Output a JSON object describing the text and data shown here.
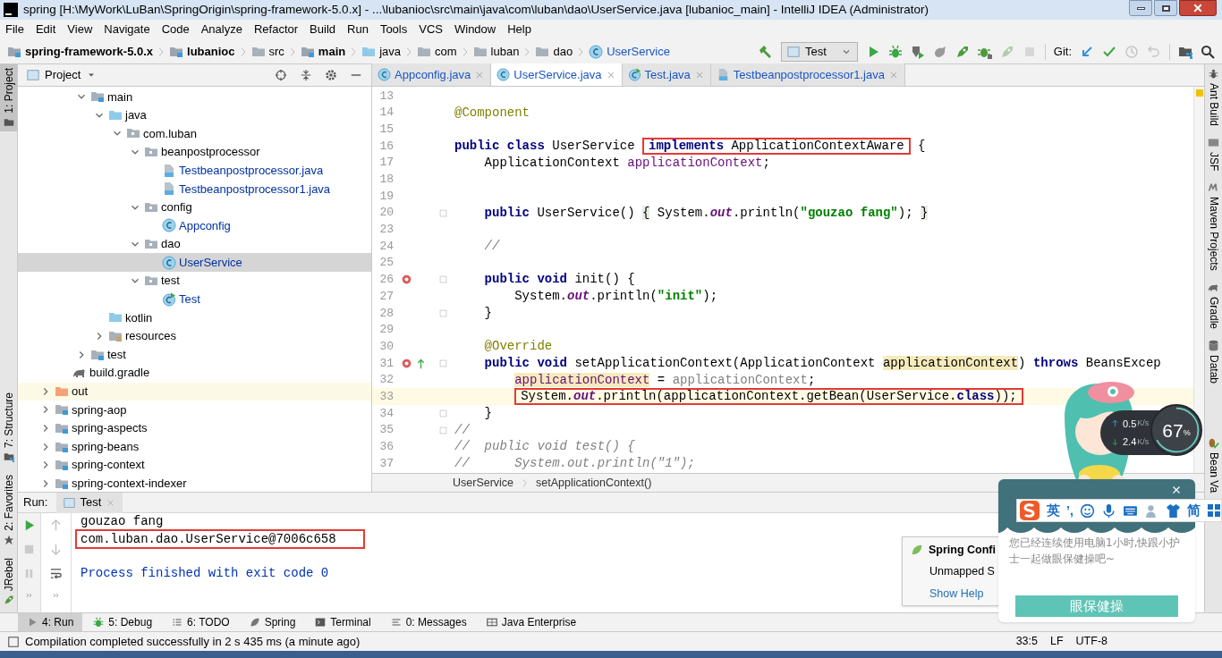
{
  "window": {
    "title": "spring [H:\\MyWork\\LuBan\\SpringOrigin\\spring-framework-5.0.x] - ...\\lubanioc\\src\\main\\java\\com\\luban\\dao\\UserService.java [lubanioc_main] - IntelliJ IDEA (Administrator)"
  },
  "menu": [
    "File",
    "Edit",
    "View",
    "Navigate",
    "Code",
    "Analyze",
    "Refactor",
    "Build",
    "Run",
    "Tools",
    "VCS",
    "Window",
    "Help"
  ],
  "breadcrumbs": [
    {
      "label": "spring-framework-5.0.x",
      "kind": "module",
      "bold": true
    },
    {
      "label": "lubanioc",
      "kind": "module",
      "bold": true
    },
    {
      "label": "src",
      "kind": "folder",
      "bold": false
    },
    {
      "label": "main",
      "kind": "module",
      "bold": true
    },
    {
      "label": "java",
      "kind": "source",
      "bold": false
    },
    {
      "label": "com",
      "kind": "folder",
      "bold": false
    },
    {
      "label": "luban",
      "kind": "folder",
      "bold": false
    },
    {
      "label": "dao",
      "kind": "folder",
      "bold": false
    },
    {
      "label": "UserService",
      "kind": "class",
      "bold": false
    }
  ],
  "toolbar": {
    "run_config": "Test",
    "git_label": "Git:",
    "buttons": [
      {
        "kind": "build",
        "disabled": false
      },
      {
        "kind": "run",
        "disabled": false
      },
      {
        "kind": "debug",
        "disabled": false
      },
      {
        "kind": "coverage",
        "disabled": false
      },
      {
        "kind": "profile",
        "disabled": false
      },
      {
        "kind": "rocket",
        "disabled": false
      },
      {
        "kind": "rocket-bug",
        "disabled": false
      },
      {
        "kind": "rocket",
        "disabled": true
      },
      {
        "kind": "stop",
        "disabled": true
      }
    ],
    "git_buttons": [
      {
        "kind": "update",
        "disabled": false
      },
      {
        "kind": "commit",
        "disabled": false
      },
      {
        "kind": "history",
        "disabled": true
      },
      {
        "kind": "revert",
        "disabled": true
      },
      {
        "kind": "structure",
        "disabled": false
      },
      {
        "kind": "search",
        "disabled": false
      }
    ]
  },
  "left_strip": [
    {
      "label": "1: Project",
      "kind": "project",
      "selected": true
    },
    {
      "label": "7: Structure",
      "kind": "structure",
      "selected": false
    },
    {
      "label": "2: Favorites",
      "kind": "star",
      "selected": false
    },
    {
      "label": "JRebel",
      "kind": "rocket",
      "selected": false
    }
  ],
  "right_strip": [
    {
      "label": "Ant Build",
      "kind": "ant"
    },
    {
      "label": "JSF",
      "kind": "jsf"
    },
    {
      "label": "Maven Projects",
      "kind": "maven"
    },
    {
      "label": "Gradle",
      "kind": "gradle"
    },
    {
      "label": "Datab",
      "kind": "database"
    },
    {
      "label": "Bean Va",
      "kind": "bean"
    }
  ],
  "project_panel": {
    "title": "Project",
    "tree": [
      {
        "children": [
          {
            "children": [
              {
                "label": "main",
                "kind": "source-root",
                "expanded": true,
                "selected": false,
                "children": [
                  {
                    "label": "java",
                    "kind": "source",
                    "expanded": true,
                    "selected": false,
                    "children": [
                      {
                        "label": "com.luban",
                        "kind": "package",
                        "expanded": true,
                        "selected": false,
                        "children": [
                          {
                            "label": "beanpostprocessor",
                            "kind": "package",
                            "expanded": true,
                            "selected": false,
                            "children": [
                              {
                                "label": "Testbeanpostprocessor.java",
                                "kind": "java-file",
                                "selected": false,
                                "color": "#0032a0"
                              },
                              {
                                "label": "Testbeanpostprocessor1.java",
                                "kind": "java-file",
                                "selected": false,
                                "color": "#0032a0"
                              }
                            ]
                          },
                          {
                            "label": "config",
                            "kind": "package",
                            "expanded": true,
                            "selected": false,
                            "children": [
                              {
                                "label": "Appconfig",
                                "kind": "class",
                                "selected": false,
                                "color": "#0032a0"
                              }
                            ]
                          },
                          {
                            "label": "dao",
                            "kind": "package",
                            "expanded": true,
                            "selected": false,
                            "children": [
                              {
                                "label": "UserService",
                                "kind": "class",
                                "selected": true,
                                "color": "#0032a0"
                              }
                            ]
                          },
                          {
                            "label": "test",
                            "kind": "package",
                            "expanded": true,
                            "selected": false,
                            "children": [
                              {
                                "label": "Test",
                                "kind": "test-class",
                                "selected": false,
                                "color": "#0032a0"
                              }
                            ]
                          }
                        ]
                      }
                    ]
                  },
                  {
                    "label": "kotlin",
                    "kind": "source",
                    "selected": false
                  },
                  {
                    "label": "resources",
                    "kind": "resources",
                    "expanded": false,
                    "selected": false
                  }
                ]
              },
              {
                "label": "test",
                "kind": "source-root",
                "expanded": false,
                "selected": false
              }
            ]
          },
          {
            "label": "build.gradle",
            "kind": "gradle",
            "selected": false
          }
        ]
      },
      {
        "label": "out",
        "kind": "excluded",
        "expanded": false,
        "selected": false
      },
      {
        "label": "spring-aop",
        "kind": "source-root",
        "expanded": false,
        "selected": false
      },
      {
        "label": "spring-aspects",
        "kind": "source-root",
        "expanded": false,
        "selected": false
      },
      {
        "label": "spring-beans",
        "kind": "source-root",
        "expanded": false,
        "selected": false
      },
      {
        "label": "spring-context",
        "kind": "source-root",
        "expanded": false,
        "selected": false
      },
      {
        "label": "spring-context-indexer",
        "kind": "source-root",
        "expanded": false,
        "selected": false
      }
    ]
  },
  "editor_tabs": [
    {
      "label": "Appconfig.java",
      "kind": "class",
      "selected": false
    },
    {
      "label": "UserService.java",
      "kind": "class",
      "selected": true
    },
    {
      "label": "Test.java",
      "kind": "test-class",
      "selected": false
    },
    {
      "label": "Testbeanpostprocessor1.java",
      "kind": "java-file",
      "selected": false
    }
  ],
  "code": [
    {
      "number": "13"
    },
    {
      "number": "14",
      "tokens": [
        {
          "text": "@Component",
          "kind": "ann"
        }
      ]
    },
    {
      "number": "15"
    },
    {
      "number": "16",
      "tokens": [
        {
          "text": "public class",
          "kind": "kw"
        },
        {
          "text": " UserService ",
          "kind": "plain"
        },
        {
          "text": "implements",
          "kind": "kw",
          "boxed": true
        },
        {
          "text": " ApplicationContextAware",
          "kind": "plain",
          "boxed": true
        },
        {
          "text": " {",
          "kind": "plain"
        }
      ]
    },
    {
      "number": "17",
      "kind": "member",
      "tokens": [
        {
          "text": "ApplicationContext ",
          "kind": "plain"
        },
        {
          "text": "applicationContext",
          "kind": "field"
        },
        {
          "text": ";",
          "kind": "plain"
        }
      ]
    },
    {
      "number": "18"
    },
    {
      "number": "19"
    },
    {
      "number": "20",
      "kind": "member",
      "fold": true,
      "tokens": [
        {
          "text": "public",
          "kind": "kw"
        },
        {
          "text": " UserService() ",
          "kind": "plain"
        },
        {
          "text": "{",
          "kind": "folded"
        },
        {
          "text": " System.",
          "kind": "plain"
        },
        {
          "text": "out",
          "kind": "static"
        },
        {
          "text": ".println(",
          "kind": "plain"
        },
        {
          "text": "\"gouzao fang\"",
          "kind": "str"
        },
        {
          "text": "); ",
          "kind": "plain"
        },
        {
          "text": "}",
          "kind": "folded"
        }
      ]
    },
    {
      "number": "23"
    },
    {
      "number": "24",
      "kind": "member",
      "tokens": [
        {
          "text": "//",
          "kind": "cm"
        }
      ]
    },
    {
      "number": "25"
    },
    {
      "number": "26",
      "kind": "member",
      "fold": true,
      "marks": [
        {
          "kind": "method"
        }
      ],
      "tokens": [
        {
          "text": "public void",
          "kind": "kw"
        },
        {
          "text": " init() {",
          "kind": "plain"
        }
      ]
    },
    {
      "number": "27",
      "kind": "statement",
      "tokens": [
        {
          "text": "System.",
          "kind": "plain"
        },
        {
          "text": "out",
          "kind": "static"
        },
        {
          "text": ".println(",
          "kind": "plain"
        },
        {
          "text": "\"init\"",
          "kind": "str"
        },
        {
          "text": ");",
          "kind": "plain"
        }
      ]
    },
    {
      "number": "28",
      "kind": "member",
      "fold": true,
      "tokens": [
        {
          "text": "}",
          "kind": "plain"
        }
      ]
    },
    {
      "number": "29"
    },
    {
      "number": "30",
      "kind": "member",
      "tokens": [
        {
          "text": "@Override",
          "kind": "ann"
        }
      ]
    },
    {
      "number": "31",
      "kind": "member",
      "fold": true,
      "marks": [
        {
          "kind": "method"
        },
        {
          "kind": "implements"
        }
      ],
      "tokens": [
        {
          "text": "public void",
          "kind": "kw"
        },
        {
          "text": " setApplicationContext(ApplicationContext ",
          "kind": "plain"
        },
        {
          "text": "applicationContext",
          "kind": "param-hl"
        },
        {
          "text": ") ",
          "kind": "plain"
        },
        {
          "text": "throws",
          "kind": "kw"
        },
        {
          "text": " BeansExcep",
          "kind": "plain"
        }
      ]
    },
    {
      "number": "32",
      "kind": "statement",
      "tokens": [
        {
          "text": "applicationContext",
          "kind": "field-hl"
        },
        {
          "text": " = ",
          "kind": "plain"
        },
        {
          "text": "applicationContext",
          "kind": "dim"
        },
        {
          "text": ";",
          "kind": "plain"
        }
      ]
    },
    {
      "number": "33",
      "kind": "statement",
      "current": true,
      "tokens": [
        {
          "text": "System.",
          "kind": "plain",
          "boxed": true
        },
        {
          "text": "out",
          "kind": "static",
          "boxed": true
        },
        {
          "text": ".println(applicationContext.getBean(UserService.",
          "kind": "plain",
          "boxed": true
        },
        {
          "text": "class",
          "kind": "kw",
          "boxed": true
        },
        {
          "text": "));",
          "kind": "plain",
          "boxed": true
        }
      ]
    },
    {
      "number": "34",
      "kind": "member",
      "fold": true,
      "tokens": [
        {
          "text": "}",
          "kind": "plain"
        }
      ]
    },
    {
      "number": "35",
      "fold": true,
      "tokens": [
        {
          "text": "//",
          "kind": "cm"
        }
      ]
    },
    {
      "number": "36",
      "tokens": [
        {
          "text": "//  public void test() {",
          "kind": "cm"
        }
      ]
    },
    {
      "number": "37",
      "tokens": [
        {
          "text": "//      System.out.println(\"1\");",
          "kind": "cm"
        }
      ]
    }
  ],
  "editor_breadcrumbs": [
    "UserService",
    "setApplicationContext()"
  ],
  "run": {
    "label": "Run:",
    "tab": "Test",
    "controls": [
      {
        "kind": "rerun",
        "disabled": false
      },
      {
        "kind": "stop",
        "disabled": true
      },
      {
        "kind": "pause",
        "disabled": true
      },
      {
        "kind": "more",
        "disabled": false
      }
    ],
    "nav_controls": [
      {
        "kind": "up",
        "disabled": true
      },
      {
        "kind": "down",
        "disabled": true
      },
      {
        "kind": "wrap",
        "disabled": false
      },
      {
        "kind": "more",
        "disabled": false
      }
    ],
    "output": [
      {
        "text": "gouzao fang",
        "kind": "stdout",
        "boxed": false
      },
      {
        "text": "com.luban.dao.UserService@7006c658",
        "kind": "stdout",
        "boxed": true
      },
      {
        "text": "Process finished with exit code 0",
        "kind": "system",
        "boxed": false
      }
    ]
  },
  "notification": {
    "title": "Spring Confi",
    "body": "Unmapped S",
    "link": "Show Help"
  },
  "tool_windows": [
    {
      "label": "4: Run",
      "kind": "run",
      "selected": true
    },
    {
      "label": "5: Debug",
      "kind": "debug",
      "selected": false
    },
    {
      "label": "6: TODO",
      "kind": "todo",
      "selected": false
    },
    {
      "label": "Spring",
      "kind": "leaf",
      "selected": false
    },
    {
      "label": "Terminal",
      "kind": "terminal",
      "selected": false
    },
    {
      "label": "0: Messages",
      "kind": "messages",
      "selected": false
    },
    {
      "label": "Java Enterprise",
      "kind": "javaee",
      "selected": false
    }
  ],
  "status_bar": {
    "message": "Compilation completed successfully in 2 s 435 ms (a minute ago)",
    "position": "33:5",
    "line_separator": "LF",
    "encoding": "UTF-8"
  },
  "speed_meter": {
    "upload": "0.5",
    "upload_unit": "K/s",
    "download": "2.4",
    "download_unit": "K/s",
    "load": "67",
    "load_unit": "%"
  },
  "eye_reminder": {
    "message": "您已经连续使用电脑1小时,快跟小护士一起做眼保健操吧~",
    "button": "眼保健操"
  },
  "ime_bar": {
    "mode": "英",
    "punctuation": "’,",
    "script": "简"
  }
}
